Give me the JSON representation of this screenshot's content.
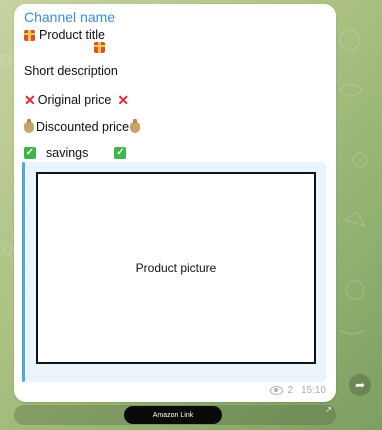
{
  "post": {
    "channel_name": "Channel name",
    "title": "Product title",
    "short_description": "Short description",
    "original_price": "Original price",
    "discounted_price": "Discounted price",
    "savings": "savings",
    "picture_label": "Product picture",
    "views": "2",
    "time": "15:10"
  },
  "buttons": {
    "amazon_link": "Amazon Link"
  },
  "colors": {
    "channel_name": "#3a8fd1",
    "preview_bar": "#52a7d8",
    "preview_bg": "#eaf4fb",
    "red_x": "#e0283a",
    "check": "#3fb44a"
  },
  "icons": {
    "gift": "gift-icon",
    "cross": "cross-mark-icon",
    "money_bag": "money-bag-icon",
    "check": "check-mark-icon",
    "eye": "eye-icon",
    "share": "share-icon",
    "expand": "expand-arrow-icon"
  }
}
